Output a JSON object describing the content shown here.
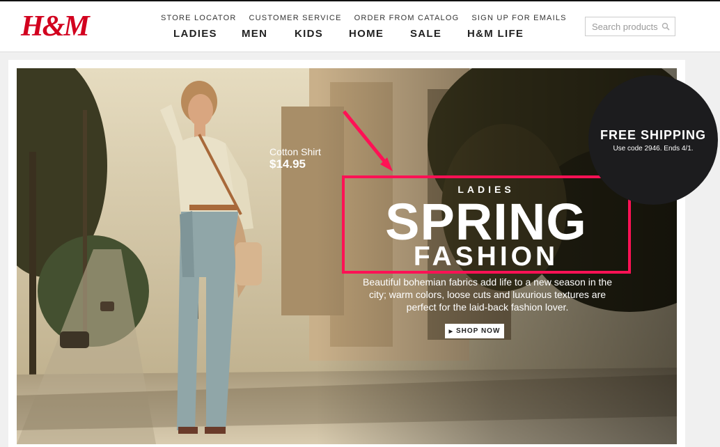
{
  "header": {
    "logo_text": "H&M",
    "utility_links": [
      "STORE LOCATOR",
      "CUSTOMER SERVICE",
      "ORDER FROM CATALOG",
      "SIGN UP FOR EMAILS"
    ],
    "main_links": [
      "LADIES",
      "MEN",
      "KIDS",
      "HOME",
      "SALE",
      "H&M LIFE"
    ],
    "search_placeholder": "Search products",
    "search_icon": "search-icon"
  },
  "hero": {
    "product_name": "Cotton Shirt",
    "product_price": "$14.95",
    "kicker": "LADIES",
    "headline": "SPRING",
    "subheadline": "FASHION",
    "description": "Beautiful bohemian fabrics add life to a new season in the city; warm colors, loose cuts and luxurious textures are perfect for the laid-back fashion lover.",
    "cta_label": "SHOP NOW"
  },
  "badge": {
    "title": "FREE SHIPPING",
    "note": "Use code 2946. Ends 4/1."
  },
  "colors": {
    "brand_red": "#d2001e",
    "highlight_pink": "#ff1155",
    "badge_bg": "#1c1c1e"
  }
}
